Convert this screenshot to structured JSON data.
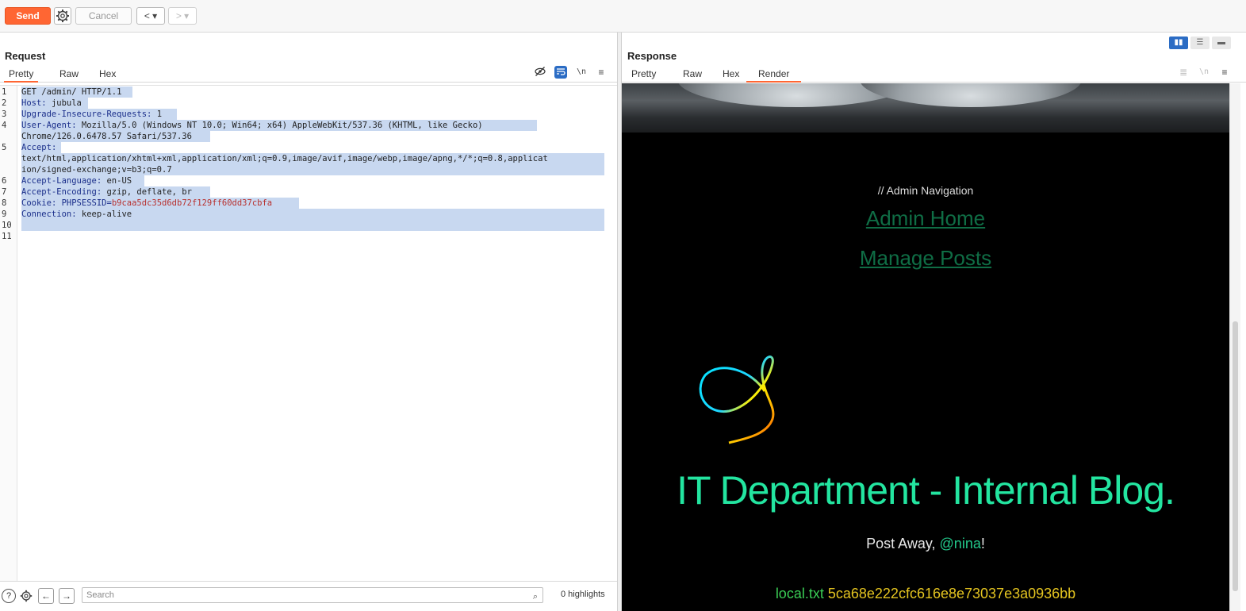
{
  "toolbar": {
    "send_label": "Send",
    "settings_icon": "gear-icon",
    "cancel_label": "Cancel",
    "back_label": "< ▾",
    "forward_label": "> ▾"
  },
  "request": {
    "title": "Request",
    "tabs": [
      "Pretty",
      "Raw",
      "Hex"
    ],
    "active_tab": "Pretty",
    "lines": [
      {
        "n": "1",
        "key": "GET /admin/ HTTP/1.1",
        "val": ""
      },
      {
        "n": "2",
        "key": "Host",
        "val": "jubula"
      },
      {
        "n": "3",
        "key": "Upgrade-Insecure-Requests",
        "val": "1"
      },
      {
        "n": "4",
        "key": "User-Agent",
        "val": "Mozilla/5.0 (Windows NT 10.0; Win64; x64) AppleWebKit/537.36 (KHTML, like Gecko)"
      },
      {
        "n": "",
        "key": "",
        "val": "Chrome/126.0.6478.57 Safari/537.36"
      },
      {
        "n": "5",
        "key": "Accept",
        "val": ""
      },
      {
        "n": "",
        "key": "",
        "val": "text/html,application/xhtml+xml,application/xml;q=0.9,image/avif,image/webp,image/apng,*/*;q=0.8,applicat"
      },
      {
        "n": "",
        "key": "",
        "val": "ion/signed-exchange;v=b3;q=0.7"
      },
      {
        "n": "6",
        "key": "Accept-Language",
        "val": "en-US"
      },
      {
        "n": "7",
        "key": "Accept-Encoding",
        "val": "gzip, deflate, br"
      },
      {
        "n": "8",
        "key": "Cookie",
        "val": "PHPSESSID=",
        "cookie": "b9caa5dc35d6db72f129ff60dd37cbfa"
      },
      {
        "n": "9",
        "key": "Connection",
        "val": "keep-alive"
      },
      {
        "n": "10",
        "key": "",
        "val": ""
      },
      {
        "n": "11",
        "key": "",
        "val": ""
      }
    ]
  },
  "bottom": {
    "search_placeholder": "Search",
    "highlights": "0 highlights"
  },
  "response": {
    "title": "Response",
    "tabs": [
      "Pretty",
      "Raw",
      "Hex",
      "Render"
    ],
    "active_tab": "Render",
    "render": {
      "nav_label": "// Admin Navigation",
      "links": [
        "Admin Home",
        "Manage Posts"
      ],
      "blog_title": "IT Department - Internal Blog.",
      "post_away_prefix": "Post Away, ",
      "mention": "@nina",
      "post_away_suffix": "!",
      "flag_key": "local.txt",
      "flag_value": "5ca68e222cfc616e8e73037e3a0936bb"
    }
  },
  "colors": {
    "accent": "#ff6633",
    "blog_title": "#23e5a0",
    "link": "#0f6d45",
    "flag_key": "#3acd55",
    "flag_value": "#e5c520"
  }
}
